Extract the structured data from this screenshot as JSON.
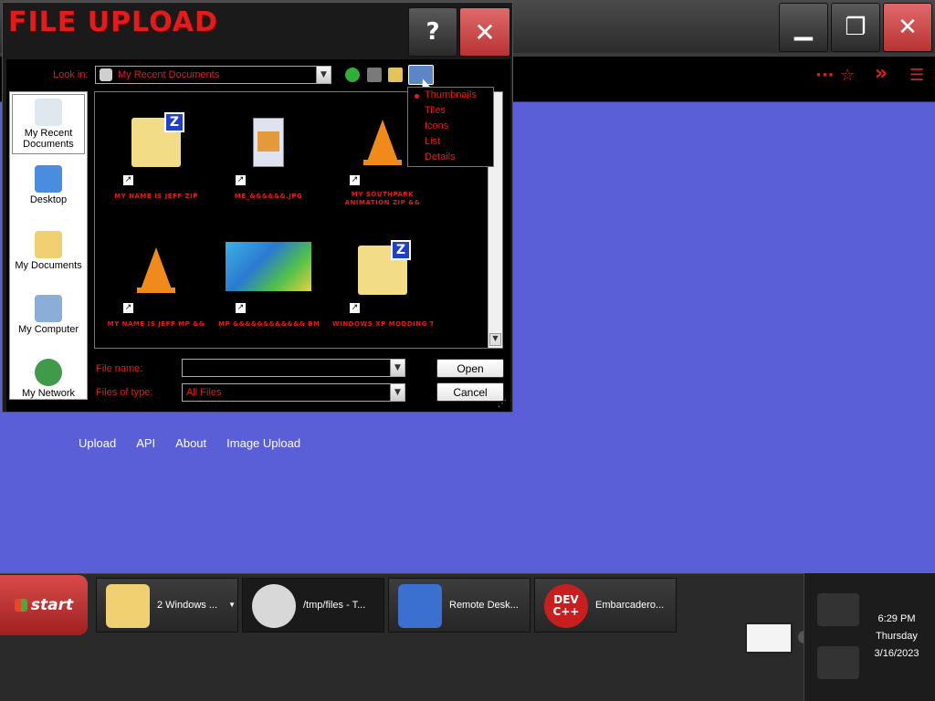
{
  "browser": {
    "minimize_glyph": "▁",
    "restore_glyph": "❐",
    "close_glyph": "✕",
    "toolbar_icons": [
      "more-icon",
      "star-icon",
      "overflow-icon",
      "menu-icon"
    ],
    "more_glyph": "···",
    "star_glyph": "☆",
    "overflow_glyph": "»",
    "menu_glyph": "☰"
  },
  "page": {
    "links": [
      "Upload",
      "API",
      "About",
      "Image Upload"
    ]
  },
  "dialog": {
    "title": "FILE UPLOAD",
    "help_glyph": "?",
    "close_glyph": "✕",
    "look_in_label": "Look in:",
    "look_in_value": "My Recent Documents",
    "places": [
      "My Recent Documents",
      "Desktop",
      "My Documents",
      "My Computer",
      "My Network"
    ],
    "files": [
      {
        "name": "MY NAME IS JEFF ZIP",
        "icon": "zip-folder-icon"
      },
      {
        "name": "ME_&&&&&&.JPG",
        "icon": "image-file-icon"
      },
      {
        "name": "MY SOUTHPARK ANIMATION ZIP &&",
        "icon": "vlc-cone-icon"
      },
      {
        "name": "MY NAME IS JEFF MP &&",
        "icon": "vlc-cone-icon"
      },
      {
        "name": "MP &&&&&&&&&&&& BMP",
        "icon": "game-screenshot-thumbnail"
      },
      {
        "name": "WINDOWS XP MODDING TOOL ZIP",
        "icon": "zip-folder-icon"
      }
    ],
    "view_menu": {
      "items": [
        "Thumbnails",
        "Tiles",
        "Icons",
        "List",
        "Details"
      ],
      "selected": "Thumbnails"
    },
    "file_name_label": "File name:",
    "file_name_value": "",
    "files_of_type_label": "Files of type:",
    "files_of_type_value": "All Files",
    "open_label": "Open",
    "cancel_label": "Cancel"
  },
  "taskbar": {
    "start_label": "start",
    "tasks": [
      {
        "label": "2 Windows ...",
        "icon": "folder-icon"
      },
      {
        "label": "/tmp/files - T...",
        "icon": "raccoon-icon"
      },
      {
        "label": "Remote Desk...",
        "icon": "remote-desktop-icon"
      },
      {
        "label": "Embarcadero...",
        "icon": "devcpp-icon"
      }
    ],
    "clock": {
      "time": "6:29 PM",
      "day": "Thursday",
      "date": "3/16/2023"
    }
  },
  "colors": {
    "accent_red": "#e21b1b",
    "page_background": "#5a5fd8",
    "dialog_background": "#000000"
  }
}
